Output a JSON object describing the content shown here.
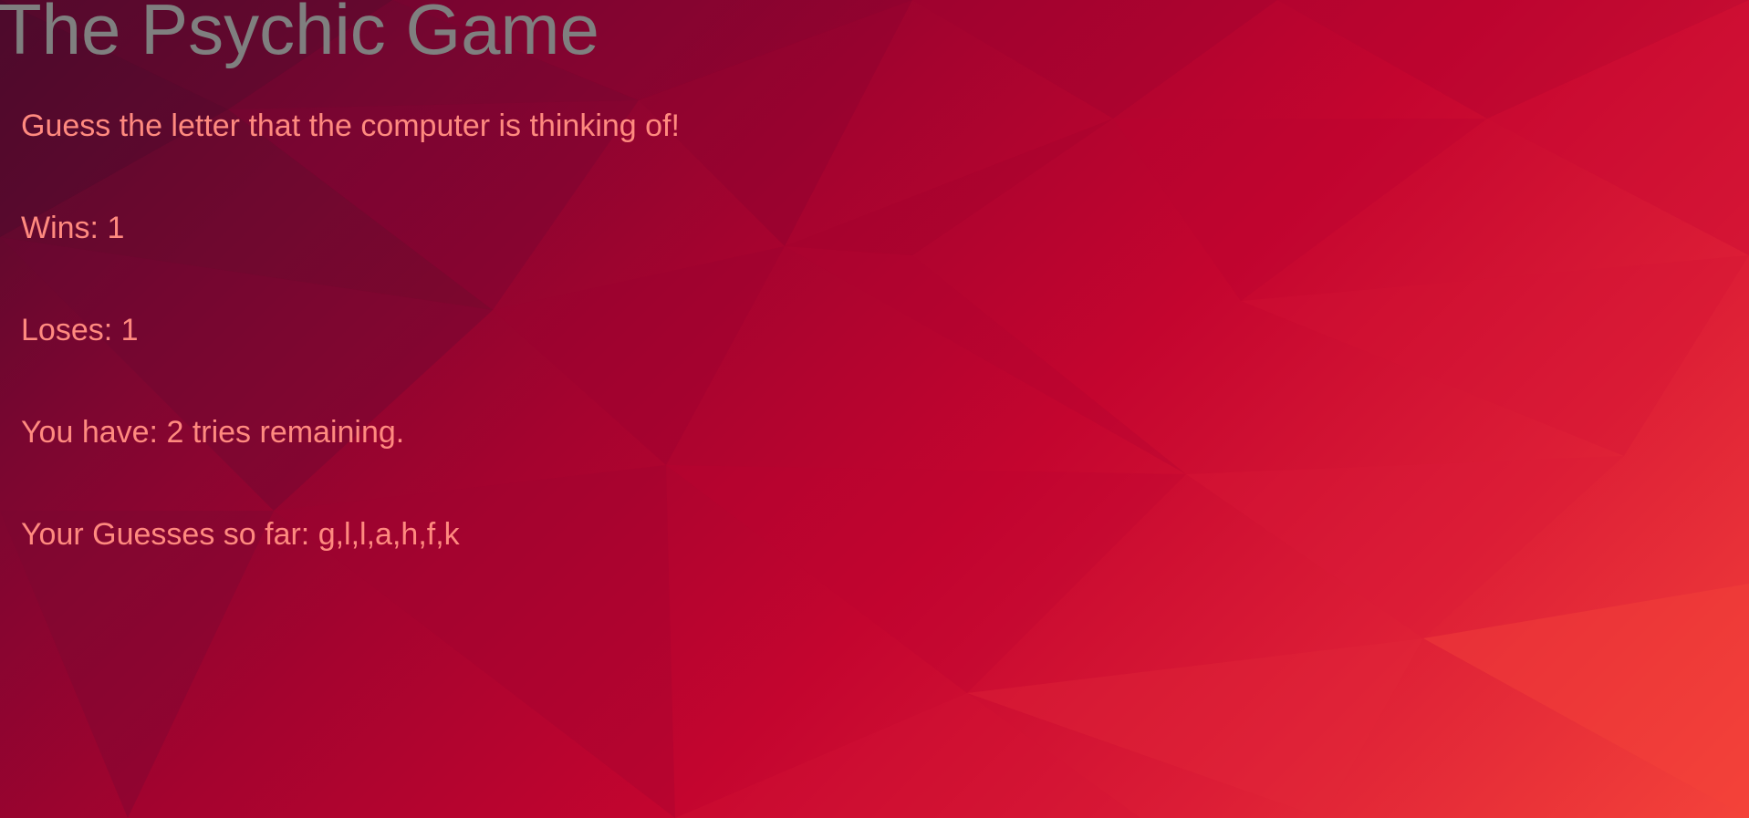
{
  "title": "The Psychic Game",
  "instructions": "Guess the letter that the computer is thinking of!",
  "stats": {
    "wins_label": "Wins:",
    "wins": "1",
    "losses_label": "Loses:",
    "losses": "1",
    "tries_prefix": "You have:",
    "tries": "2",
    "tries_suffix": "tries remaining.",
    "guesses_label": "Your Guesses so far:",
    "guesses": "g,l,l,a,h,f,k"
  },
  "colors": {
    "title": "#7f7f7f",
    "text": "#ff8a7f",
    "background_dark": "#4e0a2c",
    "background_mid": "#c4052f",
    "background_light": "#f4433a"
  }
}
